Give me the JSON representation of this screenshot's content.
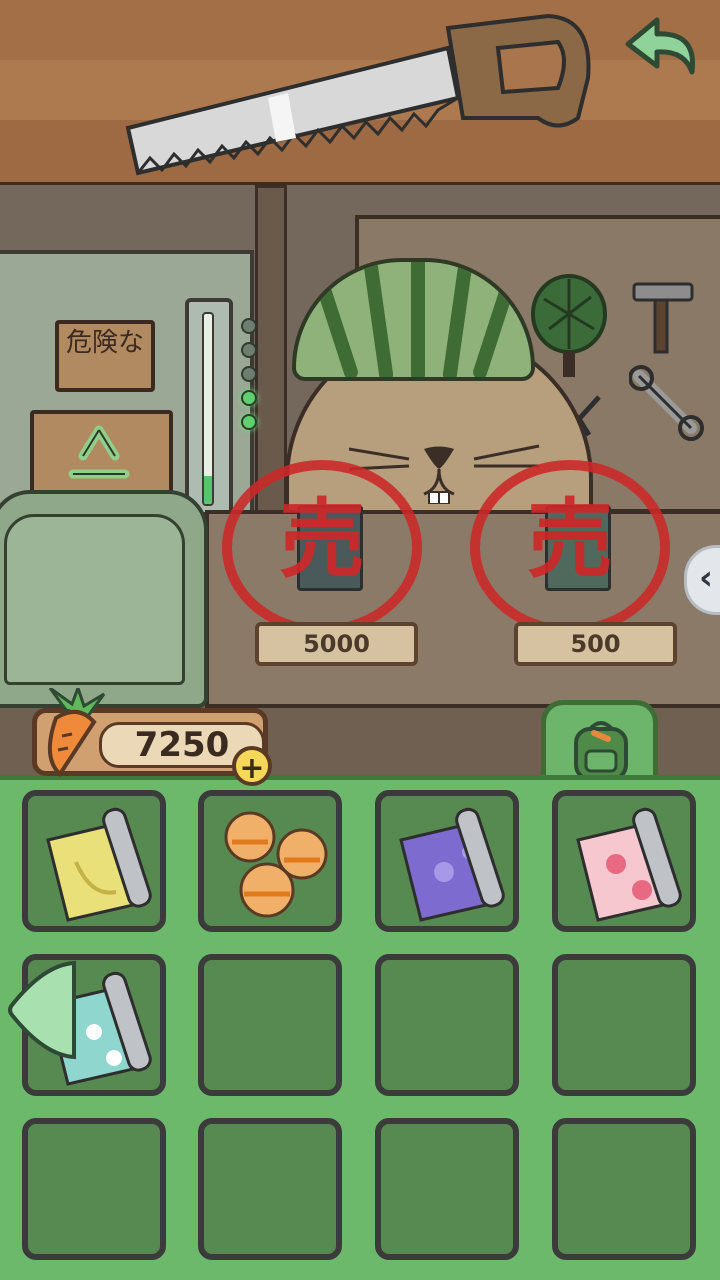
{
  "game": {
    "currency": {
      "icon": "carrot-icon",
      "amount": "7250",
      "add_label": "+"
    },
    "back_button": {
      "icon": "back-arrow-icon"
    },
    "side_nav": {
      "icon": "chevron-left-icon"
    },
    "shop": {
      "signs": {
        "danger_text": "危険な",
        "recycle_icon": "recycle-icon"
      },
      "items_for_sale": [
        {
          "name": "sold item 1",
          "status_char": "売",
          "price": "5000"
        },
        {
          "name": "sold item 2",
          "status_char": "売",
          "price": "500"
        }
      ]
    },
    "inventory": {
      "tab_icon": "backpack-icon",
      "slots": [
        {
          "item": "yellow-banana-wrapping-paper-icon"
        },
        {
          "item": "animal-cookies-icon"
        },
        {
          "item": "purple-sakura-wrapping-paper-icon"
        },
        {
          "item": "pink-plum-wrapping-paper-icon"
        },
        {
          "item": "teal-flower-wrapping-paper-icon"
        },
        {
          "item": ""
        },
        {
          "item": ""
        },
        {
          "item": ""
        },
        {
          "item": ""
        },
        {
          "item": ""
        },
        {
          "item": ""
        },
        {
          "item": ""
        }
      ]
    },
    "colors": {
      "inventory_bg": "#6db96b",
      "slot_bg": "#568a50",
      "stamp_red": "#cc2828"
    }
  }
}
